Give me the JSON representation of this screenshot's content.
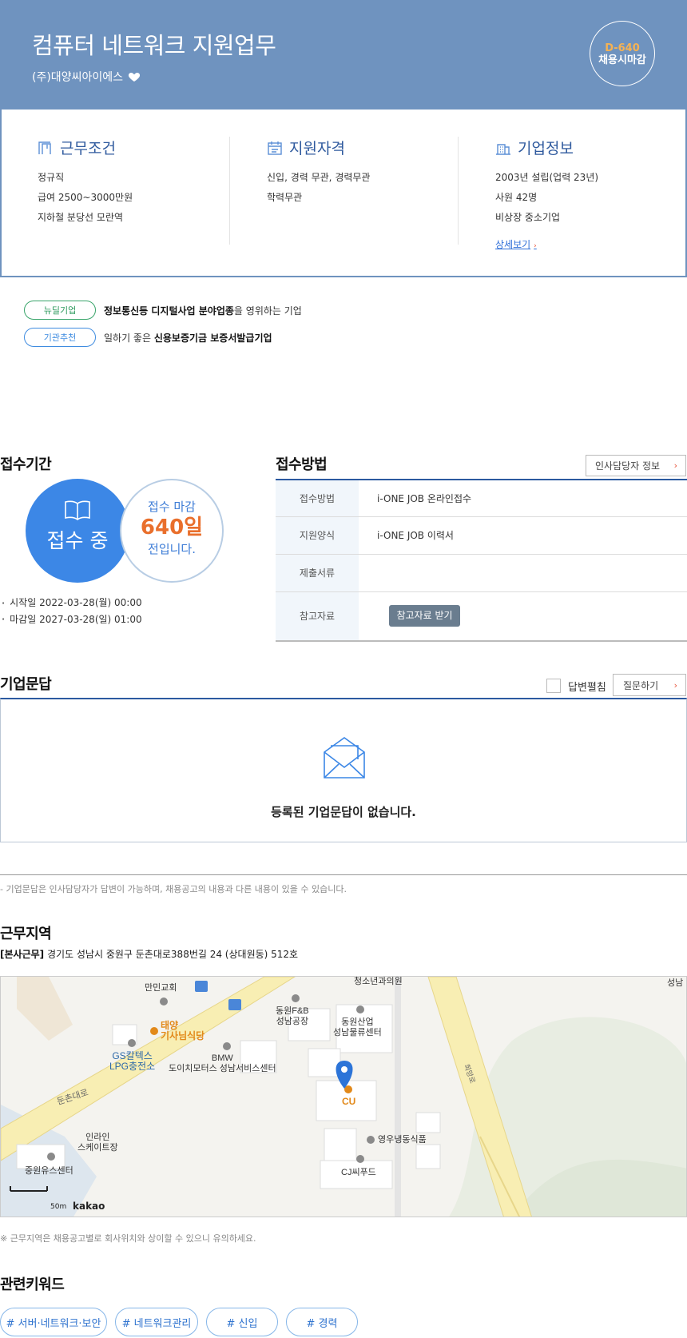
{
  "header": {
    "job_title": "컴퓨터 네트워크 지원업무",
    "company": "(주)대양씨아이에스",
    "dday": "D-640",
    "dday_label": "채용시마감"
  },
  "info": {
    "work": {
      "title": "근무조건",
      "lines": [
        "정규직",
        "급여 2500~3000만원",
        "지하철 분당선 모란역"
      ]
    },
    "qual": {
      "title": "지원자격",
      "lines": [
        "신입, 경력 무관, 경력무관",
        "학력무관"
      ]
    },
    "corp": {
      "title": "기업정보",
      "lines": [
        "2003년 설립(업력 23년)",
        "사원 42명",
        "비상장 중소기업"
      ],
      "detail_link": "상세보기"
    }
  },
  "badges": [
    {
      "label": "뉴딜기업",
      "pre": "",
      "bold": "정보통신등 디지털사업 분야업종",
      "post": "을 영위하는 기업"
    },
    {
      "label": "기관추천",
      "pre": "일하기 좋은 ",
      "bold": "신용보증기금 보증서발급기업",
      "post": ""
    }
  ],
  "period": {
    "title": "접수기간",
    "status": "접수 중",
    "sub_top": "접수 마감",
    "sub_days": "640일",
    "sub_bottom": "전입니다.",
    "start": "시작일 2022-03-28(월) 00:00",
    "end": "마감일 2027-03-28(일) 01:00"
  },
  "method": {
    "title": "접수방법",
    "hr_button": "인사담당자 정보",
    "rows": [
      {
        "label": "접수방법",
        "value": "i-ONE JOB 온라인접수"
      },
      {
        "label": "지원양식",
        "value": "i-ONE JOB 이력서"
      },
      {
        "label": "제출서류",
        "value": ""
      },
      {
        "label": "참고자료",
        "button": "참고자료 받기"
      }
    ]
  },
  "qa": {
    "title": "기업문답",
    "checkbox_label": "답변펼침",
    "ask_button": "질문하기",
    "empty": "등록된 기업문답이 없습니다.",
    "note": "- 기업문답은 인사담당자가 답변이 가능하며, 채용공고의 내용과 다른 내용이 있을 수 있습니다."
  },
  "location": {
    "title": "근무지역",
    "address_tag": "[본사근무]",
    "address": " 경기도 성남시 중원구 둔촌대로388번길 24 (상대원동) 512호",
    "note": "※ 근무지역은 채용공고별로 회사위치와 상이할 수 있으니 유의하세요.",
    "map": {
      "labels": {
        "church": "만민교회",
        "clinic": "청소년과의원",
        "seongnam": "성남",
        "dongwon_fb": "동원F&B\n성남공장",
        "dongwon_ind": "동원산업\n성남물류센터",
        "restaurant": "태양\n기사님식당",
        "gs": "GS칼텍스\nLPG충전소",
        "bmw": "BMW\n도이치모터스 성남서비스센터",
        "road": "둔촌대로",
        "road2": "희망로",
        "cu": "CU",
        "skate": "인라인\n스케이트장",
        "youngwoo": "영우냉동식품",
        "oil": "중원유스센터",
        "cj": "CJ씨푸드"
      },
      "scale": "50m",
      "provider": "kakao"
    }
  },
  "keywords": {
    "title": "관련키워드",
    "items": [
      "# 서버·네트워크·보안",
      "# 네트워크관리",
      "# 신입",
      "# 경력"
    ]
  },
  "colors": {
    "header_bg": "#6f93bf",
    "accent_blue": "#3c87e6",
    "orange": "#e96f2c",
    "table_border": "#2c5aa0"
  },
  "icons": {
    "work": "door-icon",
    "qual": "calendar-icon",
    "corp": "building-icon",
    "period": "book-icon",
    "qa": "mail-icon",
    "map_pin": "map-pin-icon"
  }
}
